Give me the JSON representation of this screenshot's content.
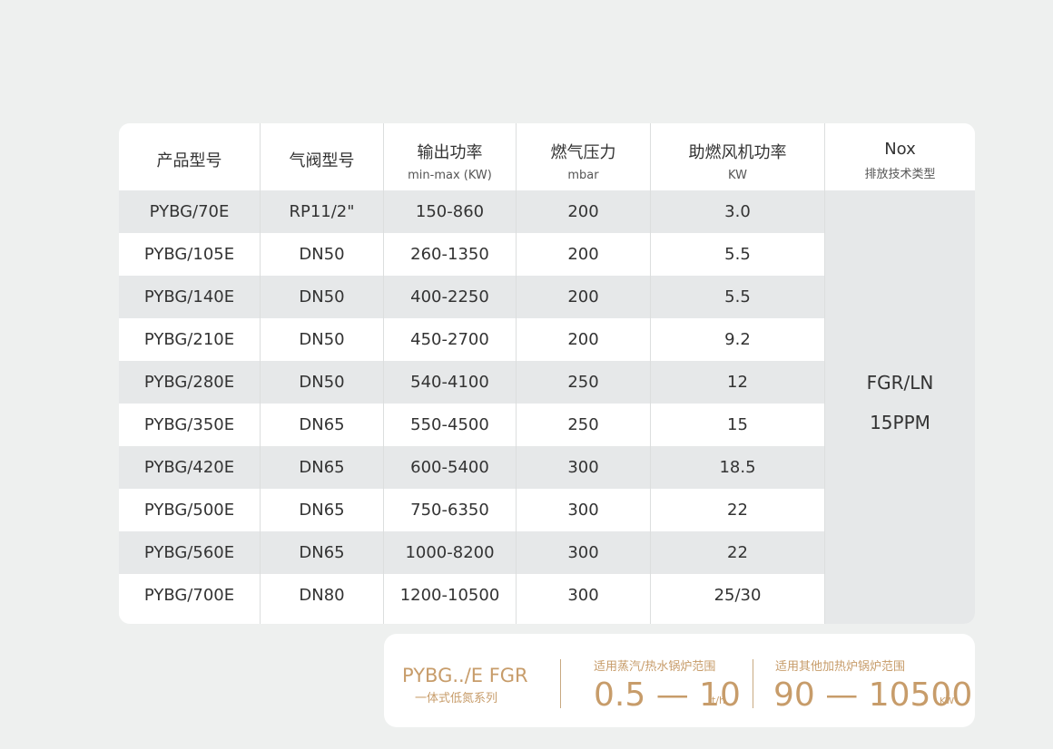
{
  "table": {
    "headers": [
      {
        "main": "产品型号",
        "sub": ""
      },
      {
        "main": "气阀型号",
        "sub": ""
      },
      {
        "main": "输出功率",
        "sub": "min-max (KW)"
      },
      {
        "main": "燃气压力",
        "sub": "mbar"
      },
      {
        "main": "助燃风机功率",
        "sub": "KW"
      },
      {
        "main": "Nox",
        "sub": "排放技术类型"
      }
    ],
    "rows": [
      [
        "PYBG/70E",
        "RP11/2\"",
        "150-860",
        "200",
        "3.0"
      ],
      [
        "PYBG/105E",
        "DN50",
        "260-1350",
        "200",
        "5.5"
      ],
      [
        "PYBG/140E",
        "DN50",
        "400-2250",
        "200",
        "5.5"
      ],
      [
        "PYBG/210E",
        "DN50",
        "450-2700",
        "200",
        "9.2"
      ],
      [
        "PYBG/280E",
        "DN50",
        "540-4100",
        "250",
        "12"
      ],
      [
        "PYBG/350E",
        "DN65",
        "550-4500",
        "250",
        "15"
      ],
      [
        "PYBG/420E",
        "DN65",
        "600-5400",
        "300",
        "18.5"
      ],
      [
        "PYBG/500E",
        "DN65",
        "750-6350",
        "300",
        "22"
      ],
      [
        "PYBG/560E",
        "DN65",
        "1000-8200",
        "300",
        "22"
      ],
      [
        "PYBG/700E",
        "DN80",
        "1200-10500",
        "300",
        "25/30"
      ]
    ],
    "nox": {
      "line1": "FGR/LN",
      "line2": "15PPM"
    }
  },
  "summary": {
    "series_name": "PYBG../E FGR",
    "series_sub": "一体式低氮系列",
    "steam": {
      "label": "适用蒸汽/热水锅炉范围",
      "value": "0.5 — 10",
      "unit": "t/h"
    },
    "other": {
      "label": "适用其他加热炉锅炉范围",
      "value": "90 — 10500",
      "unit": "KW"
    }
  },
  "colors": {
    "background": "#eef0ef",
    "row_shade": "#e6e8e9",
    "accent": "#c79c6a"
  }
}
